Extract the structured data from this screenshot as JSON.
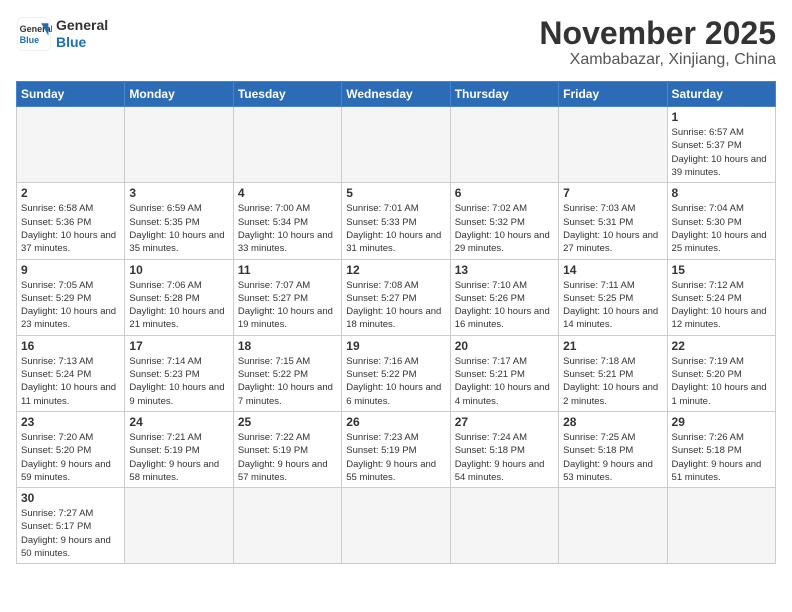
{
  "logo": {
    "line1": "General",
    "line2": "Blue"
  },
  "title": "November 2025",
  "subtitle": "Xambabazar, Xinjiang, China",
  "days_of_week": [
    "Sunday",
    "Monday",
    "Tuesday",
    "Wednesday",
    "Thursday",
    "Friday",
    "Saturday"
  ],
  "weeks": [
    [
      {
        "day": "",
        "info": ""
      },
      {
        "day": "",
        "info": ""
      },
      {
        "day": "",
        "info": ""
      },
      {
        "day": "",
        "info": ""
      },
      {
        "day": "",
        "info": ""
      },
      {
        "day": "",
        "info": ""
      },
      {
        "day": "1",
        "info": "Sunrise: 6:57 AM\nSunset: 5:37 PM\nDaylight: 10 hours and 39 minutes."
      }
    ],
    [
      {
        "day": "2",
        "info": "Sunrise: 6:58 AM\nSunset: 5:36 PM\nDaylight: 10 hours and 37 minutes."
      },
      {
        "day": "3",
        "info": "Sunrise: 6:59 AM\nSunset: 5:35 PM\nDaylight: 10 hours and 35 minutes."
      },
      {
        "day": "4",
        "info": "Sunrise: 7:00 AM\nSunset: 5:34 PM\nDaylight: 10 hours and 33 minutes."
      },
      {
        "day": "5",
        "info": "Sunrise: 7:01 AM\nSunset: 5:33 PM\nDaylight: 10 hours and 31 minutes."
      },
      {
        "day": "6",
        "info": "Sunrise: 7:02 AM\nSunset: 5:32 PM\nDaylight: 10 hours and 29 minutes."
      },
      {
        "day": "7",
        "info": "Sunrise: 7:03 AM\nSunset: 5:31 PM\nDaylight: 10 hours and 27 minutes."
      },
      {
        "day": "8",
        "info": "Sunrise: 7:04 AM\nSunset: 5:30 PM\nDaylight: 10 hours and 25 minutes."
      }
    ],
    [
      {
        "day": "9",
        "info": "Sunrise: 7:05 AM\nSunset: 5:29 PM\nDaylight: 10 hours and 23 minutes."
      },
      {
        "day": "10",
        "info": "Sunrise: 7:06 AM\nSunset: 5:28 PM\nDaylight: 10 hours and 21 minutes."
      },
      {
        "day": "11",
        "info": "Sunrise: 7:07 AM\nSunset: 5:27 PM\nDaylight: 10 hours and 19 minutes."
      },
      {
        "day": "12",
        "info": "Sunrise: 7:08 AM\nSunset: 5:27 PM\nDaylight: 10 hours and 18 minutes."
      },
      {
        "day": "13",
        "info": "Sunrise: 7:10 AM\nSunset: 5:26 PM\nDaylight: 10 hours and 16 minutes."
      },
      {
        "day": "14",
        "info": "Sunrise: 7:11 AM\nSunset: 5:25 PM\nDaylight: 10 hours and 14 minutes."
      },
      {
        "day": "15",
        "info": "Sunrise: 7:12 AM\nSunset: 5:24 PM\nDaylight: 10 hours and 12 minutes."
      }
    ],
    [
      {
        "day": "16",
        "info": "Sunrise: 7:13 AM\nSunset: 5:24 PM\nDaylight: 10 hours and 11 minutes."
      },
      {
        "day": "17",
        "info": "Sunrise: 7:14 AM\nSunset: 5:23 PM\nDaylight: 10 hours and 9 minutes."
      },
      {
        "day": "18",
        "info": "Sunrise: 7:15 AM\nSunset: 5:22 PM\nDaylight: 10 hours and 7 minutes."
      },
      {
        "day": "19",
        "info": "Sunrise: 7:16 AM\nSunset: 5:22 PM\nDaylight: 10 hours and 6 minutes."
      },
      {
        "day": "20",
        "info": "Sunrise: 7:17 AM\nSunset: 5:21 PM\nDaylight: 10 hours and 4 minutes."
      },
      {
        "day": "21",
        "info": "Sunrise: 7:18 AM\nSunset: 5:21 PM\nDaylight: 10 hours and 2 minutes."
      },
      {
        "day": "22",
        "info": "Sunrise: 7:19 AM\nSunset: 5:20 PM\nDaylight: 10 hours and 1 minute."
      }
    ],
    [
      {
        "day": "23",
        "info": "Sunrise: 7:20 AM\nSunset: 5:20 PM\nDaylight: 9 hours and 59 minutes."
      },
      {
        "day": "24",
        "info": "Sunrise: 7:21 AM\nSunset: 5:19 PM\nDaylight: 9 hours and 58 minutes."
      },
      {
        "day": "25",
        "info": "Sunrise: 7:22 AM\nSunset: 5:19 PM\nDaylight: 9 hours and 57 minutes."
      },
      {
        "day": "26",
        "info": "Sunrise: 7:23 AM\nSunset: 5:19 PM\nDaylight: 9 hours and 55 minutes."
      },
      {
        "day": "27",
        "info": "Sunrise: 7:24 AM\nSunset: 5:18 PM\nDaylight: 9 hours and 54 minutes."
      },
      {
        "day": "28",
        "info": "Sunrise: 7:25 AM\nSunset: 5:18 PM\nDaylight: 9 hours and 53 minutes."
      },
      {
        "day": "29",
        "info": "Sunrise: 7:26 AM\nSunset: 5:18 PM\nDaylight: 9 hours and 51 minutes."
      }
    ],
    [
      {
        "day": "30",
        "info": "Sunrise: 7:27 AM\nSunset: 5:17 PM\nDaylight: 9 hours and 50 minutes."
      },
      {
        "day": "",
        "info": ""
      },
      {
        "day": "",
        "info": ""
      },
      {
        "day": "",
        "info": ""
      },
      {
        "day": "",
        "info": ""
      },
      {
        "day": "",
        "info": ""
      },
      {
        "day": "",
        "info": ""
      }
    ]
  ]
}
